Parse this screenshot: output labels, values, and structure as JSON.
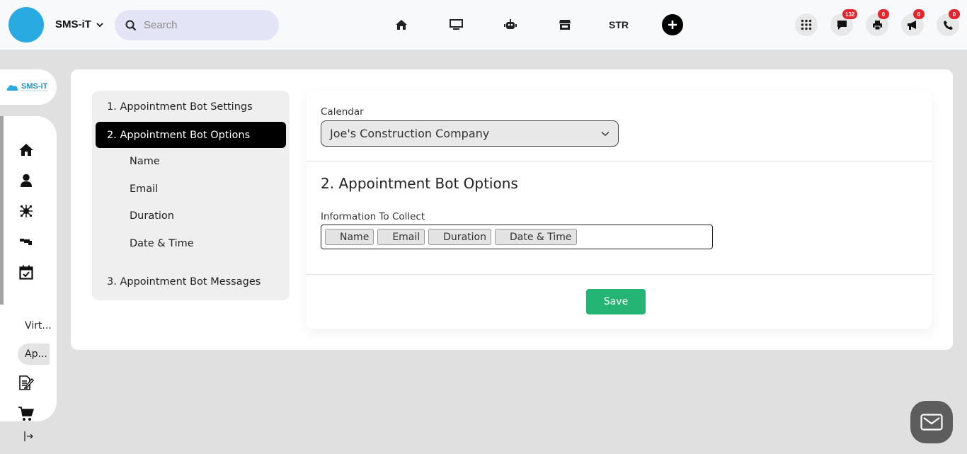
{
  "topbar": {
    "brand": "SMS-iT",
    "search_placeholder": "Search",
    "nav": [
      {
        "icon": "home-icon"
      },
      {
        "icon": "monitor-icon"
      },
      {
        "icon": "robot-icon"
      },
      {
        "icon": "store-icon"
      },
      {
        "label": "STR"
      },
      {
        "icon": "plus-icon"
      }
    ],
    "actions": [
      {
        "icon": "apps-grid-icon",
        "badge": null
      },
      {
        "icon": "chat-icon",
        "badge": "132"
      },
      {
        "icon": "printer-icon",
        "badge": "0"
      },
      {
        "icon": "megaphone-icon",
        "badge": "0"
      },
      {
        "icon": "phone-icon",
        "badge": "0"
      }
    ]
  },
  "sidebar": {
    "logo_text": "SMS-iT",
    "items": [
      {
        "icon": "home-icon"
      },
      {
        "icon": "user-icon"
      },
      {
        "icon": "network-icon"
      },
      {
        "icon": "pipeline-icon"
      },
      {
        "icon": "calendar-check-icon"
      },
      {
        "label": "Virt..."
      },
      {
        "label": "Ap...",
        "active": true
      },
      {
        "icon": "document-edit-icon"
      },
      {
        "icon": "cart-icon"
      }
    ],
    "collapse_icon": "collapse-icon"
  },
  "steps": {
    "items": [
      {
        "label": "1. Appointment Bot Settings"
      },
      {
        "label": "2. Appointment Bot Options",
        "active": true
      },
      {
        "label": "3. Appointment Bot Messages"
      }
    ],
    "subitems": [
      "Name",
      "Email",
      "Duration",
      "Date & Time"
    ]
  },
  "form": {
    "calendar_label": "Calendar",
    "calendar_value": "Joe's Construction Company",
    "section_title": "2. Appointment Bot Options",
    "info_label": "Information To Collect",
    "tags": [
      "Name",
      "Email",
      "Duration",
      "Date & Time"
    ],
    "save_label": "Save"
  },
  "colors": {
    "accent_save": "#24b574",
    "badge": "#e5242b",
    "avatar": "#29abe2",
    "active_step": "#000000"
  }
}
